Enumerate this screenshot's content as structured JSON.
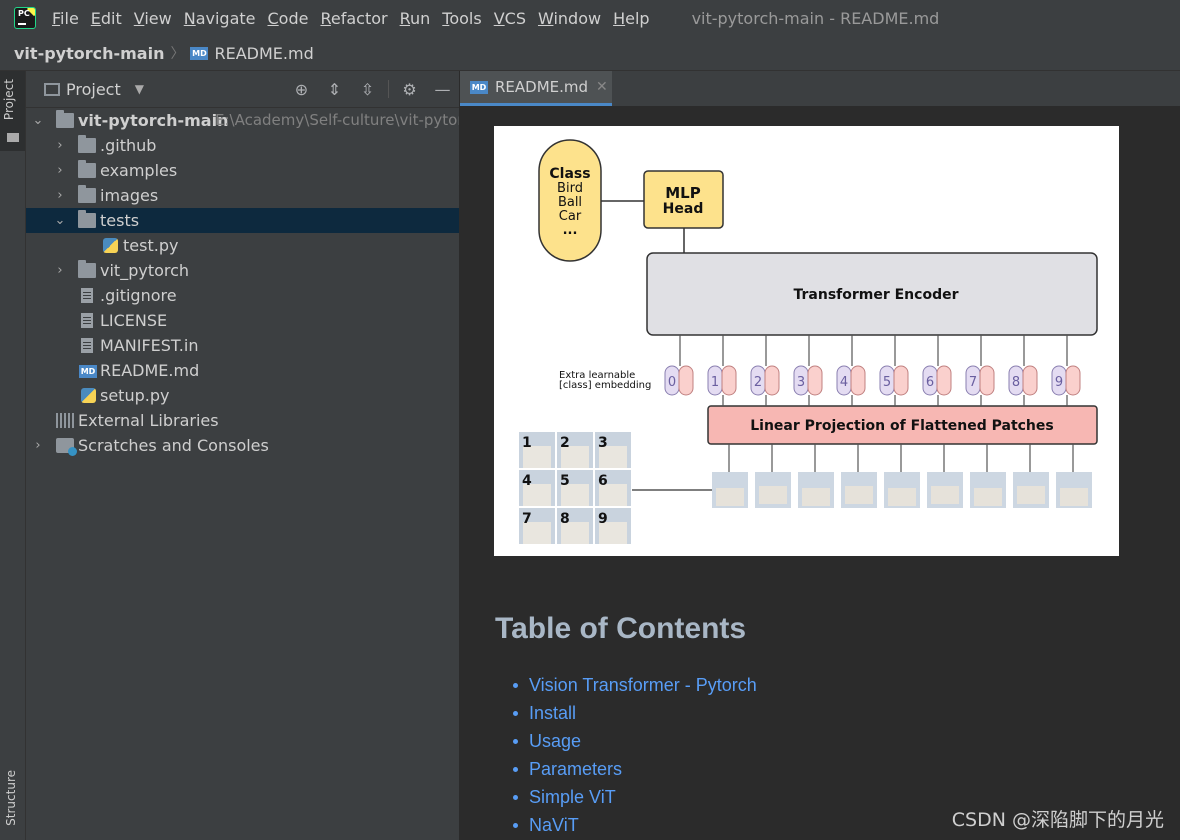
{
  "menu": {
    "items": [
      "File",
      "Edit",
      "View",
      "Navigate",
      "Code",
      "Refactor",
      "Run",
      "Tools",
      "VCS",
      "Window",
      "Help"
    ],
    "window_title": "vit-pytorch-main - README.md"
  },
  "navbar": {
    "project": "vit-pytorch-main",
    "file": "README.md"
  },
  "stripe": {
    "project_label": "Project",
    "structure_label": "Structure"
  },
  "project_panel": {
    "title": "Project",
    "tree": [
      {
        "label": "vit-pytorch-main",
        "path": "E:\\Academy\\Self-culture\\vit-pytorch-main"
      },
      {
        "label": ".github"
      },
      {
        "label": "examples"
      },
      {
        "label": "images"
      },
      {
        "label": "tests"
      },
      {
        "label": "test.py"
      },
      {
        "label": "vit_pytorch"
      },
      {
        "label": ".gitignore"
      },
      {
        "label": "LICENSE"
      },
      {
        "label": "MANIFEST.in"
      },
      {
        "label": "README.md"
      },
      {
        "label": "setup.py"
      },
      {
        "label": "External Libraries"
      },
      {
        "label": "Scratches and Consoles"
      }
    ]
  },
  "editor": {
    "tab_label": "README.md",
    "figure": {
      "class_box": [
        "Class",
        "Bird",
        "Ball",
        "Car",
        "..."
      ],
      "mlp_head": [
        "MLP",
        "Head"
      ],
      "encoder": "Transformer Encoder",
      "extra_embedding": [
        "Extra learnable",
        "[class] embedding"
      ],
      "tokens": [
        "0",
        "1",
        "2",
        "3",
        "4",
        "5",
        "6",
        "7",
        "8",
        "9"
      ],
      "projection": "Linear Projection of Flattened Patches",
      "patches": [
        "1",
        "2",
        "3",
        "4",
        "5",
        "6",
        "7",
        "8",
        "9"
      ]
    },
    "toc_title": "Table of Contents",
    "toc_items": [
      "Vision Transformer - Pytorch",
      "Install",
      "Usage",
      "Parameters",
      "Simple ViT",
      "NaViT"
    ]
  },
  "watermark": "CSDN @深陷脚下的月光",
  "colors": {
    "selection": "#0d293e",
    "link": "#589df6",
    "tab_underline": "#4a88c7",
    "class_box": "#fde28c",
    "encoder": "#e0e0e4",
    "projection": "#f7b7b3"
  }
}
